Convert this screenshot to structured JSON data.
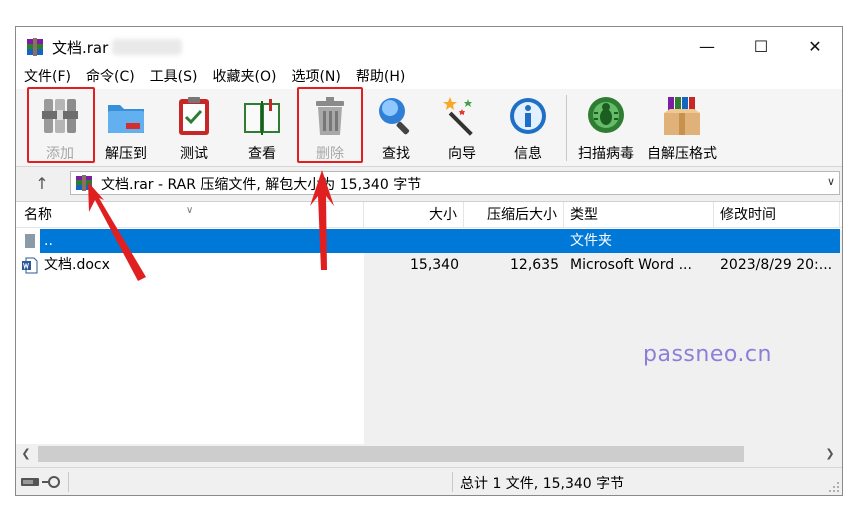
{
  "window": {
    "title": "文档.rar",
    "controls": {
      "minimize": "—",
      "maximize": "☐",
      "close": "✕"
    }
  },
  "menu": [
    "文件(F)",
    "命令(C)",
    "工具(S)",
    "收藏夹(O)",
    "选项(N)",
    "帮助(H)"
  ],
  "toolbar": {
    "add": "添加",
    "extract": "解压到",
    "test": "测试",
    "view": "查看",
    "delete": "删除",
    "find": "查找",
    "wizard": "向导",
    "info": "信息",
    "scan": "扫描病毒",
    "sfx": "自解压格式"
  },
  "address": {
    "up": "↑",
    "text": "文档.rar - RAR 压缩文件, 解包大小为 15,340 字节"
  },
  "columns": {
    "name": "名称",
    "size": "大小",
    "packed": "压缩后大小",
    "type": "类型",
    "modified": "修改时间"
  },
  "rows": [
    {
      "name": "..",
      "size": "",
      "packed": "",
      "type": "文件夹",
      "modified": ""
    },
    {
      "name": "文档.docx",
      "size": "15,340",
      "packed": "12,635",
      "type": "Microsoft Word ...",
      "modified": "2023/8/29 20:..."
    }
  ],
  "status": {
    "summary": "总计 1 文件, 15,340 字节"
  },
  "watermark": "passneo.cn",
  "colors": {
    "highlight": "#e02020",
    "selection": "#0078d7",
    "watermark": "#8b7fd8"
  }
}
